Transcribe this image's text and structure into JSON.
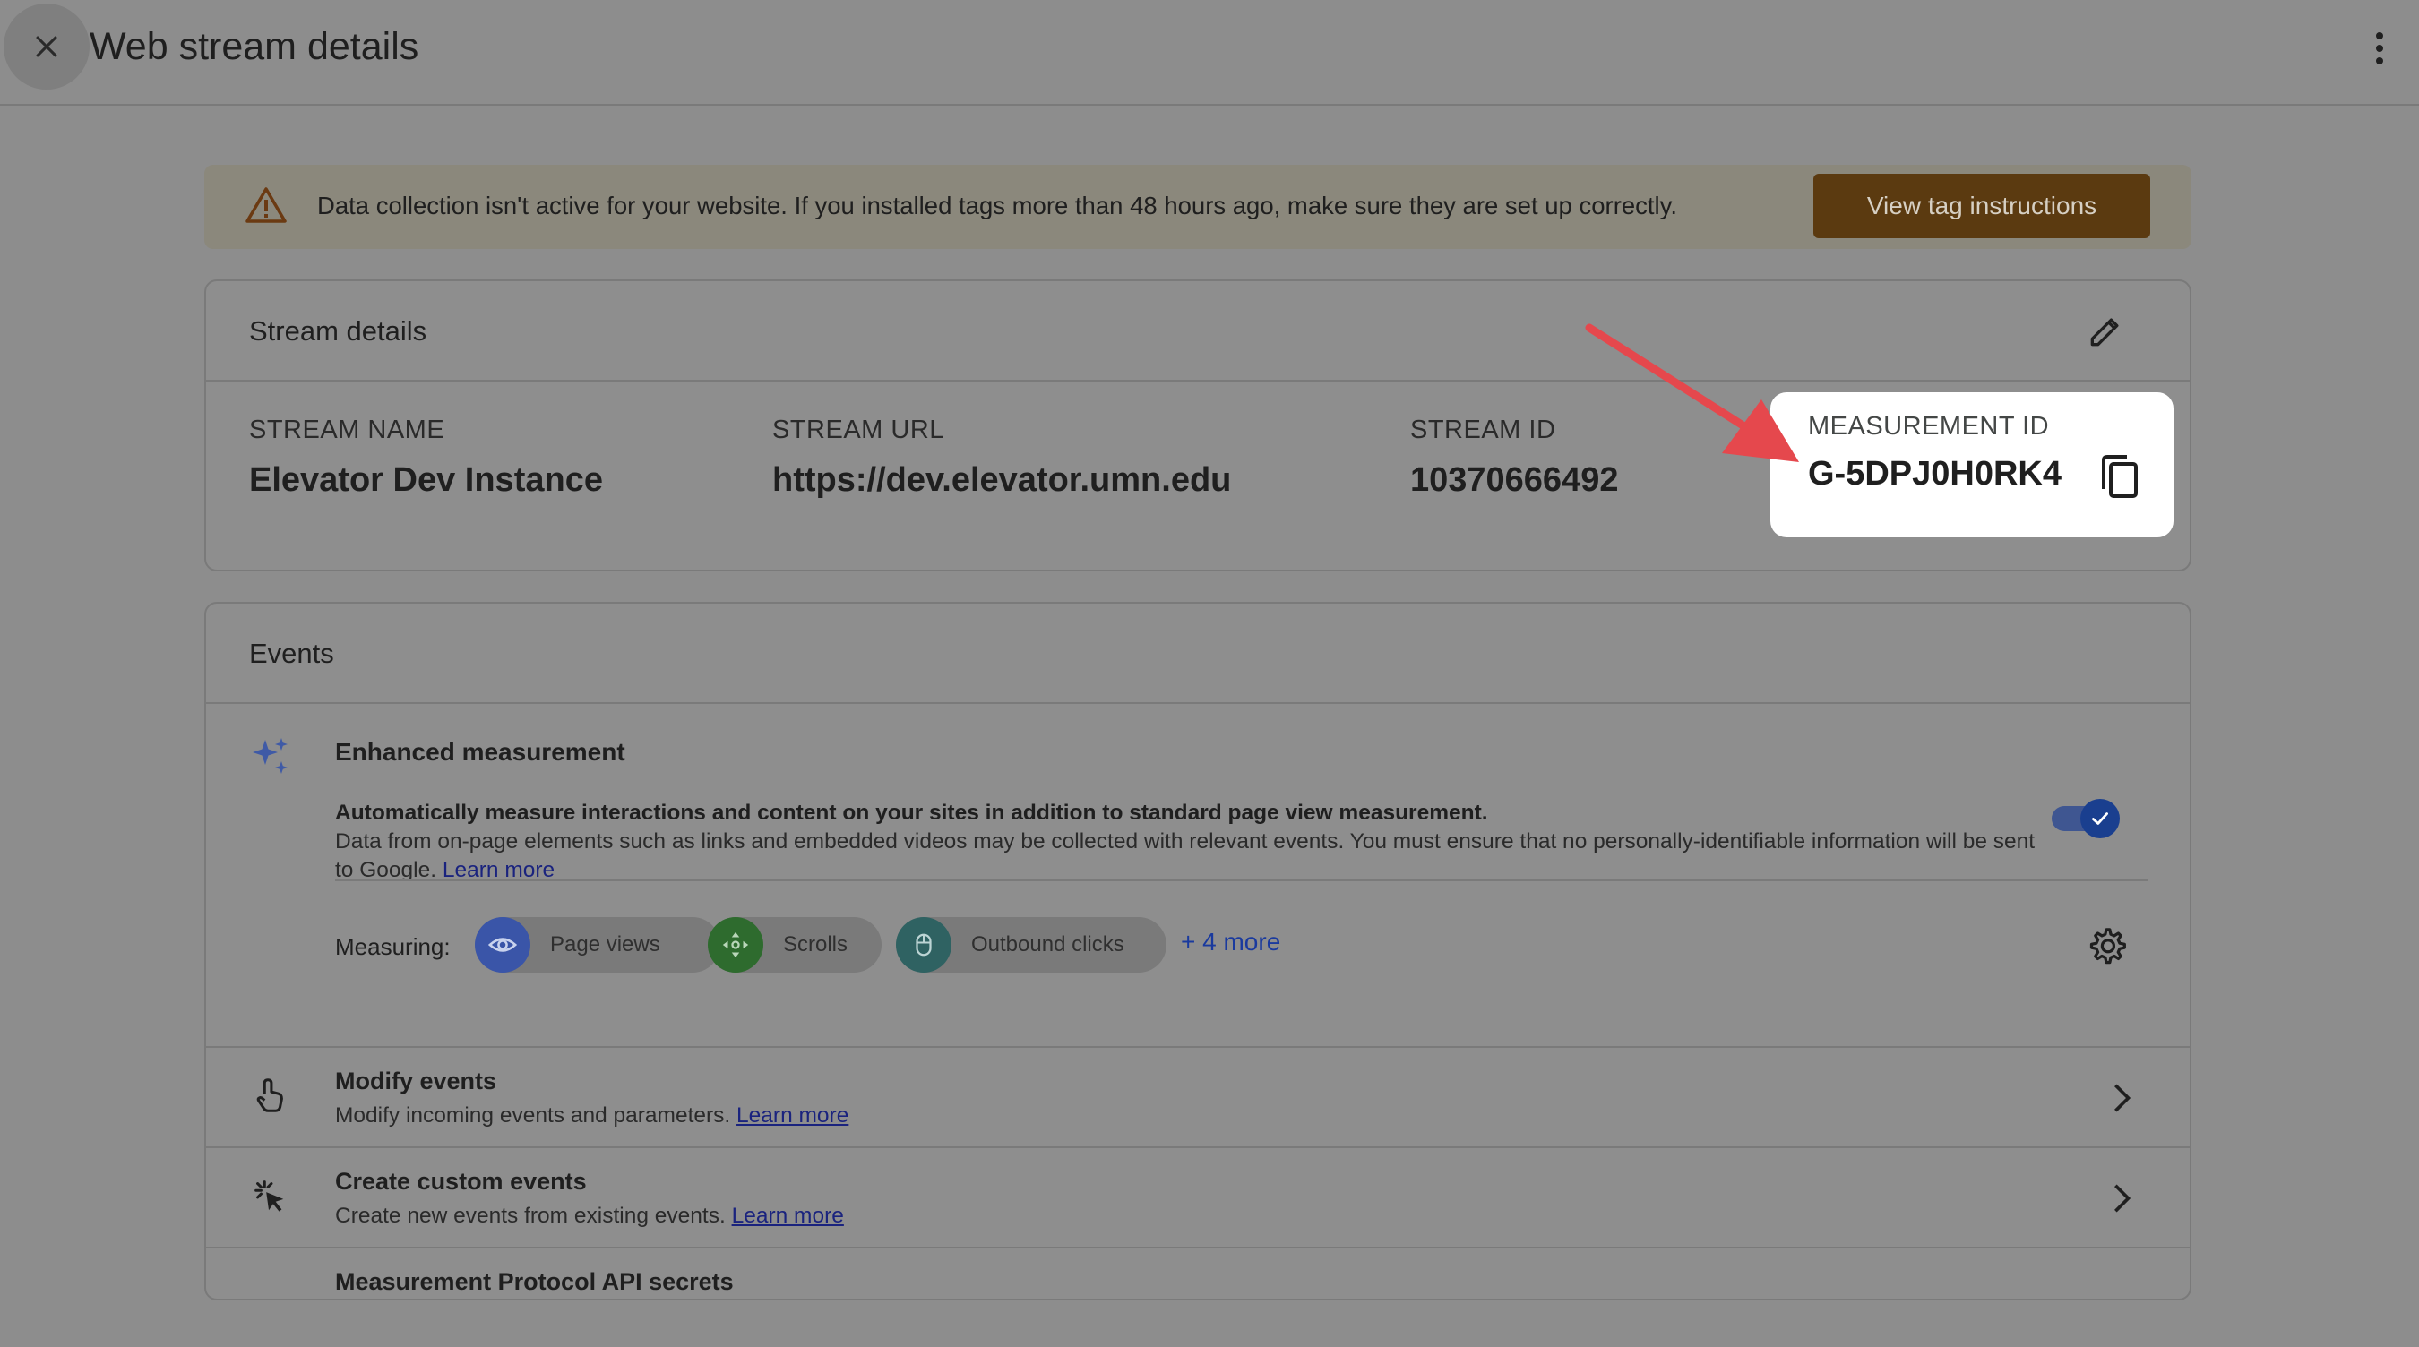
{
  "header": {
    "title": "Web stream details"
  },
  "banner": {
    "message": "Data collection isn't active for your website. If you installed tags more than 48 hours ago, make sure they are set up correctly.",
    "button_label": "View tag instructions"
  },
  "stream_details": {
    "title": "Stream details",
    "fields": {
      "name": {
        "label": "STREAM NAME",
        "value": "Elevator Dev Instance"
      },
      "url": {
        "label": "STREAM URL",
        "value": "https://dev.elevator.umn.edu"
      },
      "id": {
        "label": "STREAM ID",
        "value": "10370666492"
      },
      "measurement": {
        "label": "MEASUREMENT ID",
        "value": "G-5DPJ0H0RK4"
      }
    }
  },
  "events": {
    "title": "Events",
    "enhanced": {
      "title": "Enhanced measurement",
      "desc_bold": "Automatically measure interactions and content on your sites in addition to standard page view measurement.",
      "desc": "Data from on-page elements such as links and embedded videos may be collected with relevant events. You must ensure that no personally-identifiable information will be sent to Google.",
      "learn_more": "Learn more",
      "enabled": true,
      "measuring_label": "Measuring:",
      "chips": [
        {
          "label": "Page views",
          "icon": "eye-icon",
          "color": "#3a55a8"
        },
        {
          "label": "Scrolls",
          "icon": "scroll-icon",
          "color": "#2e6b2e"
        },
        {
          "label": "Outbound clicks",
          "icon": "mouse-icon",
          "color": "#2f6262"
        }
      ],
      "more_label": "+ 4 more"
    },
    "rows": [
      {
        "title": "Modify events",
        "subtitle": "Modify incoming events and parameters.",
        "link": "Learn more"
      },
      {
        "title": "Create custom events",
        "subtitle": "Create new events from existing events.",
        "link": "Learn more"
      },
      {
        "title": "Measurement Protocol API secrets"
      }
    ]
  },
  "colors": {
    "accent_button": "#5b3a10",
    "highlight_box": "#ffffff",
    "arrow": "#e5484d",
    "link": "#1a237e"
  }
}
